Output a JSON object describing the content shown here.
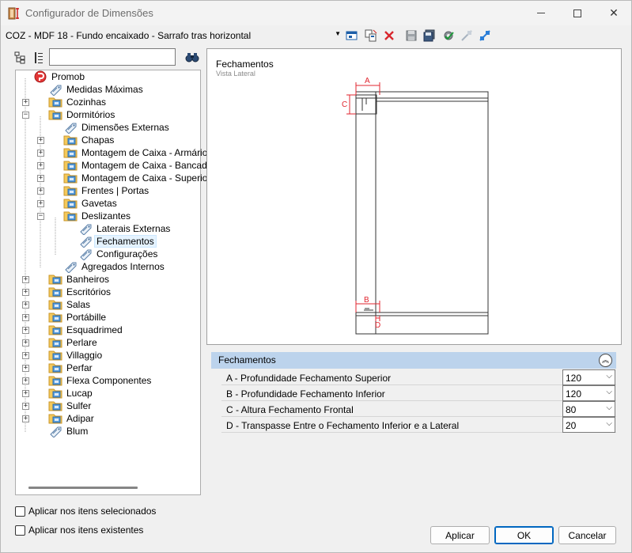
{
  "window": {
    "title": "Configurador de Dimensões"
  },
  "toolbar": {
    "config_value": "COZ - MDF 18 - Fundo encaixado - Sarrafo tras horizontal",
    "icons": [
      "add-window-icon",
      "copy-icon",
      "delete-icon",
      "save-icon",
      "save-as-icon",
      "settings-check-icon",
      "collapse-icon",
      "expand-icon"
    ]
  },
  "search": {
    "placeholder": "",
    "value": ""
  },
  "tree": {
    "root": "Promob",
    "items": [
      {
        "label": "Medidas Máximas"
      },
      {
        "label": "Cozinhas"
      },
      {
        "label": "Dormitórios"
      },
      {
        "label": "Dimensões Externas"
      },
      {
        "label": "Chapas"
      },
      {
        "label": "Montagem de Caixa - Armários"
      },
      {
        "label": "Montagem de Caixa - Bancadas"
      },
      {
        "label": "Montagem de Caixa - Superior"
      },
      {
        "label": "Frentes | Portas"
      },
      {
        "label": "Gavetas"
      },
      {
        "label": "Deslizantes"
      },
      {
        "label": "Laterais Externas"
      },
      {
        "label": "Fechamentos"
      },
      {
        "label": "Configurações"
      },
      {
        "label": "Agregados Internos"
      },
      {
        "label": "Banheiros"
      },
      {
        "label": "Escritórios"
      },
      {
        "label": "Salas"
      },
      {
        "label": "Portábille"
      },
      {
        "label": "Esquadrimed"
      },
      {
        "label": "Perlare"
      },
      {
        "label": "Villaggio"
      },
      {
        "label": "Perfar"
      },
      {
        "label": "Flexa Componentes"
      },
      {
        "label": "Lucap"
      },
      {
        "label": "Sulfer"
      },
      {
        "label": "Adipar"
      },
      {
        "label": "Blum"
      }
    ]
  },
  "options": {
    "apply_selected": "Aplicar nos itens selecionados",
    "apply_existing": "Aplicar nos itens existentes"
  },
  "preview": {
    "title": "Fechamentos",
    "subtitle": "Vista Lateral",
    "dim_labels": {
      "a": "A",
      "b": "B",
      "c": "C",
      "d": "D"
    },
    "accent": "#e0262f"
  },
  "properties": {
    "header": "Fechamentos",
    "rows": [
      {
        "name": "A - Profundidade Fechamento Superior",
        "value": "120"
      },
      {
        "name": "B - Profundidade Fechamento Inferior",
        "value": "120"
      },
      {
        "name": "C - Altura Fechamento Frontal",
        "value": "80"
      },
      {
        "name": "D - Transpasse Entre o Fechamento Inferior e a Lateral",
        "value": "20"
      }
    ]
  },
  "buttons": {
    "apply": "Aplicar",
    "ok": "OK",
    "cancel": "Cancelar"
  }
}
